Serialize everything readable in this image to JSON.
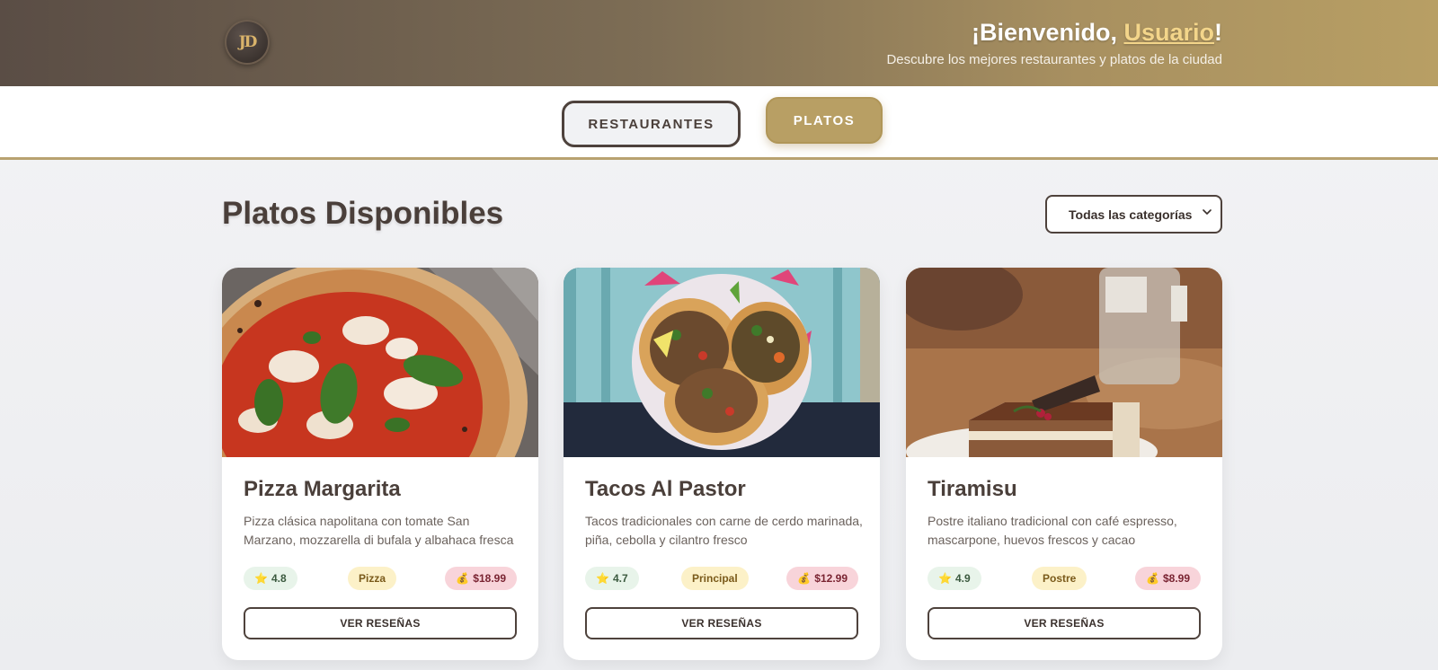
{
  "header": {
    "logo_text": "JD",
    "welcome_prefix": "¡Bienvenido, ",
    "welcome_user": "Usuario",
    "welcome_suffix": "!",
    "subtitle": "Descubre los mejores restaurantes y platos de la ciudad"
  },
  "tabs": [
    {
      "label": "RESTAURANTES",
      "active": false
    },
    {
      "label": "PLATOS",
      "active": true
    }
  ],
  "section": {
    "title": "Platos Disponibles",
    "category_filter": "Todas las categorías"
  },
  "dishes": [
    {
      "name": "Pizza Margarita",
      "description": "Pizza clásica napolitana con tomate San Marzano, mozzarella di bufala y albahaca fresca",
      "rating": "4.8",
      "category": "Pizza",
      "price": "$18.99",
      "button": "VER RESEÑAS"
    },
    {
      "name": "Tacos Al Pastor",
      "description": "Tacos tradicionales con carne de cerdo marinada, piña, cebolla y cilantro fresco",
      "rating": "4.7",
      "category": "Principal",
      "price": "$12.99",
      "button": "VER RESEÑAS"
    },
    {
      "name": "Tiramisu",
      "description": "Postre italiano tradicional con café espresso, mascarpone, huevos frescos y cacao",
      "rating": "4.9",
      "category": "Postre",
      "price": "$8.99",
      "button": "VER RESEÑAS"
    }
  ],
  "icons": {
    "rating": "star-icon",
    "price": "money-bag-icon",
    "select": "chevron-down-icon"
  },
  "colors": {
    "brand_gold": "#b89f64",
    "brand_dark": "#4e423c",
    "rating_bg": "#e8f4ea",
    "category_bg": "#fcf1c8",
    "price_bg": "#f8d4da"
  }
}
